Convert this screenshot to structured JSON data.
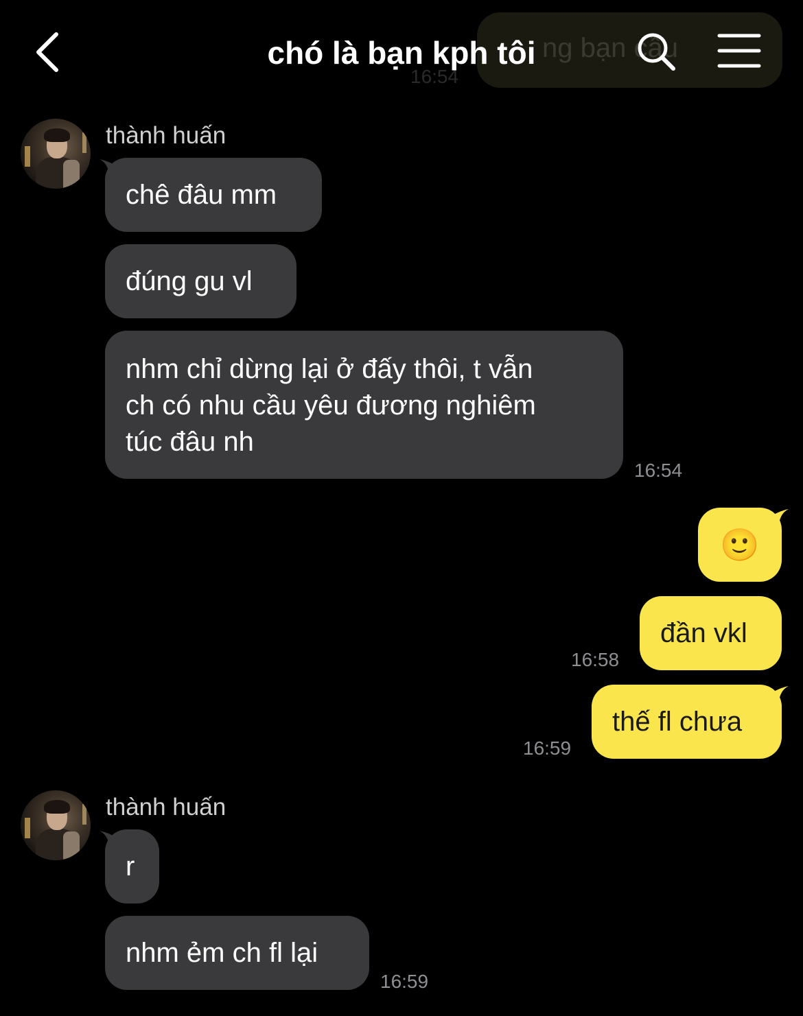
{
  "header": {
    "title": "chó là bạn kph tôi",
    "ghost_text": "ng bạn cầu",
    "ghost_time": "16:54"
  },
  "contact": {
    "name": "thành huấn"
  },
  "messages": {
    "m1": "chê đâu mm",
    "m2": "đúng gu vl",
    "m3_line1": "nhm chỉ dừng lại ở đấy thôi, t vẫn",
    "m3_line2": "ch có nhu cầu yêu đương nghiêm",
    "m3_line3": "túc đâu nh",
    "t1": "16:54",
    "m4": "🙂",
    "m5": "đần vkl",
    "t2": "16:58",
    "m6": "thế fl chưa",
    "t3": "16:59",
    "m7": "r",
    "m8": "nhm ẻm ch fl lại",
    "t4": "16:59"
  },
  "colors": {
    "background": "#000000",
    "incoming_bubble": "#3a3a3c",
    "outgoing_bubble": "#fae64c",
    "timestamp": "#8e8e93"
  },
  "icons": {
    "back": "chevron-left-icon",
    "search": "search-icon",
    "menu": "hamburger-menu-icon"
  }
}
